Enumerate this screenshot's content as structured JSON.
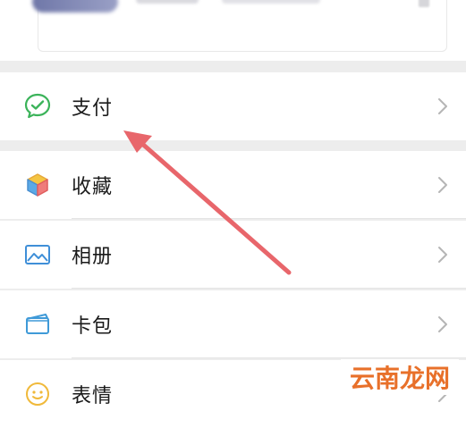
{
  "menu": [
    {
      "key": "pay",
      "label": "支付",
      "icon": "wechat-pay-icon"
    },
    {
      "key": "favorites",
      "label": "收藏",
      "icon": "cube-icon"
    },
    {
      "key": "album",
      "label": "相册",
      "icon": "picture-icon"
    },
    {
      "key": "cards",
      "label": "卡包",
      "icon": "wallet-icon"
    },
    {
      "key": "stickers",
      "label": "表情",
      "icon": "smiley-icon"
    }
  ],
  "watermark": {
    "text": "云南龙网"
  },
  "colors": {
    "arrow": "#e8666b",
    "pay_icon": "#3bb35a",
    "watermark": "#e8702a"
  }
}
